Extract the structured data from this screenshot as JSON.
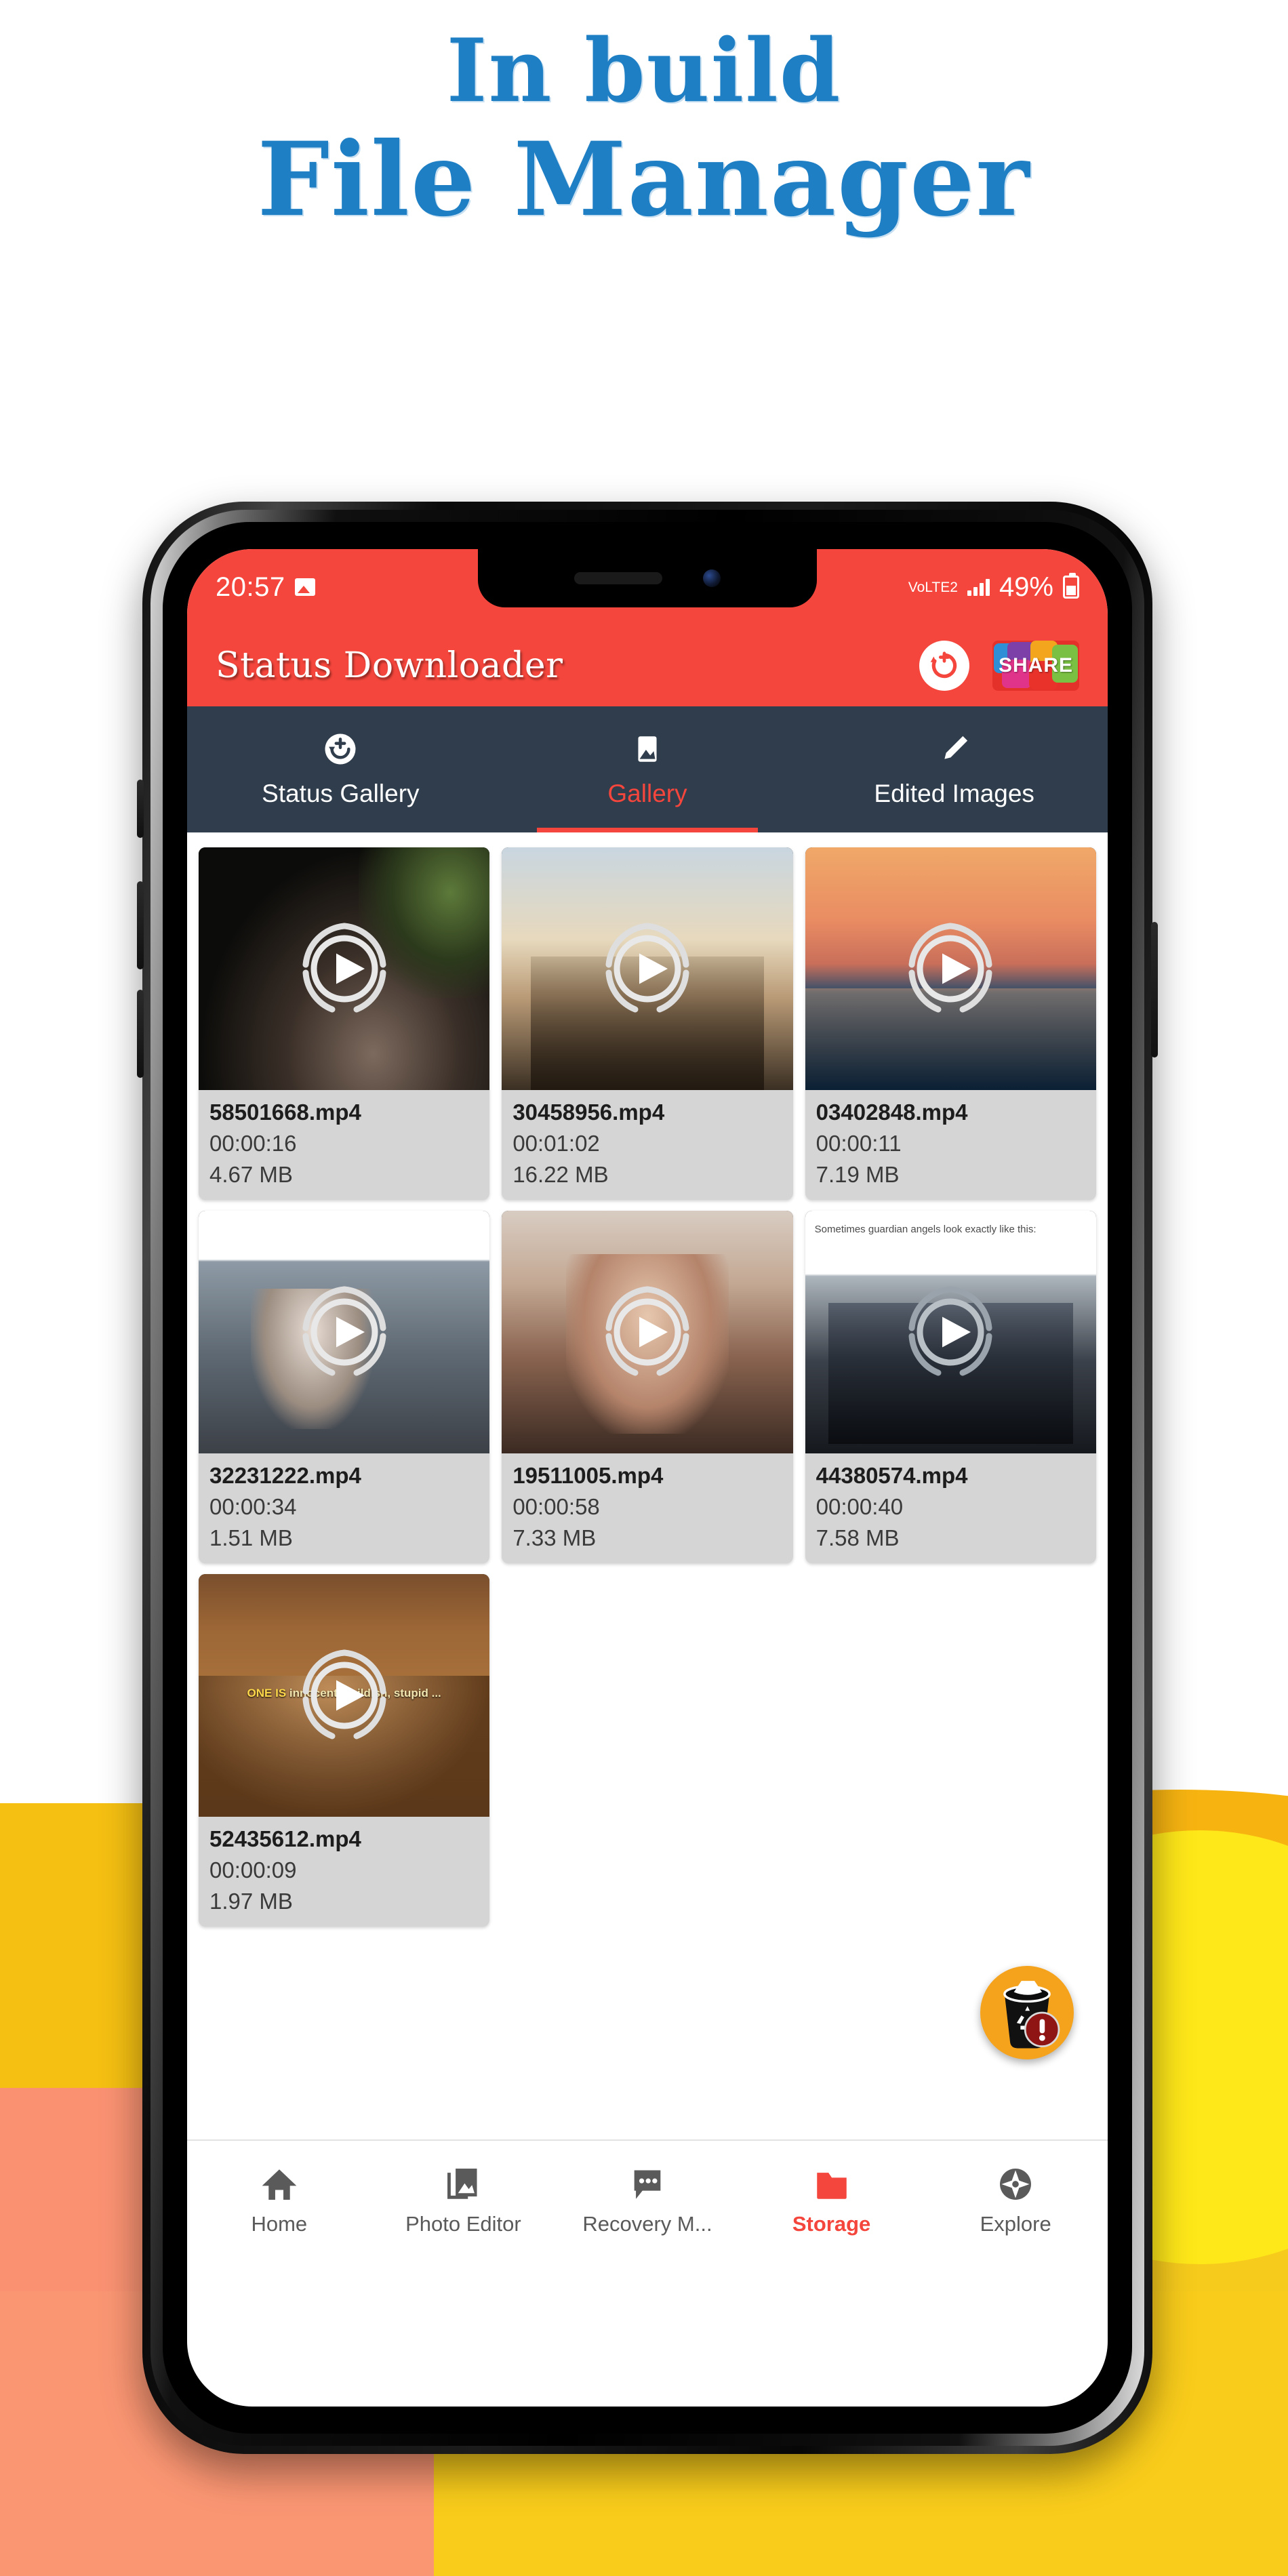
{
  "promo": {
    "line1": "In build",
    "line2": "File Manager",
    "accent_color": "#1f7fc4"
  },
  "status_bar": {
    "time": "20:57",
    "picture_icon": "image-icon",
    "network_label": "VoLTE2",
    "battery_percent": "49%",
    "battery_icon": "battery-charging-icon"
  },
  "app_bar": {
    "title": "Status Downloader",
    "refresh_icon": "refresh-icon",
    "share_label": "SHARE",
    "background_color": "#f4463c"
  },
  "tabs": {
    "active_index": 1,
    "background_color": "#2f3d4c",
    "active_color": "#f4463c",
    "items": [
      {
        "label": "Status Gallery",
        "icon": "sync-circle-icon"
      },
      {
        "label": "Gallery",
        "icon": "image-icon"
      },
      {
        "label": "Edited Images",
        "icon": "pencil-icon"
      }
    ]
  },
  "gallery": {
    "items": [
      {
        "filename": "58501668.mp4",
        "filename_prefix": "5",
        "duration": "00:00:16",
        "size": "4.67 MB",
        "scene": "scene-road",
        "caption": "",
        "play_icon": "play-circle-icon"
      },
      {
        "filename": "30458956.mp4",
        "filename_prefix": "3",
        "duration": "00:01:02",
        "size": "16.22 MB",
        "scene": "scene-street",
        "caption": "",
        "play_icon": "play-circle-icon"
      },
      {
        "filename": "03402848.mp4",
        "filename_prefix": "0",
        "duration": "00:00:11",
        "size": "7.19 MB",
        "scene": "scene-sunset",
        "caption": "",
        "play_icon": "play-circle-icon"
      },
      {
        "filename": "32231222.mp4",
        "filename_prefix": "3",
        "duration": "00:00:34",
        "size": "1.51 MB",
        "scene": "scene-news",
        "caption": "",
        "play_icon": "play-circle-icon"
      },
      {
        "filename": "19511005.mp4",
        "filename_prefix": "1",
        "duration": "00:00:58",
        "size": "7.33 MB",
        "scene": "scene-portrait",
        "caption": "",
        "play_icon": "play-circle-icon"
      },
      {
        "filename": "44380574.mp4",
        "filename_prefix": "4",
        "duration": "00:00:40",
        "size": "7.58 MB",
        "scene": "scene-men",
        "caption": "Sometimes guardian angels look exactly like this:",
        "play_icon": "play-circle-icon"
      },
      {
        "filename": "52435612.mp4",
        "filename_prefix": "5",
        "duration": "00:00:09",
        "size": "1.97 MB",
        "scene": "scene-lion",
        "caption": "",
        "overlay_text_1": "ONE IS",
        "overlay_text_2": "innocent, childish,",
        "overlay_text_3": "stupid ...",
        "play_icon": "play-circle-icon"
      }
    ],
    "delete_fab": {
      "icon": "trash-recycle-warning-icon",
      "background_color": "#f5a31d",
      "badge_color": "#8f1515"
    }
  },
  "bottom_nav": {
    "active_index": 3,
    "active_color": "#f4463c",
    "items": [
      {
        "label": "Home",
        "icon": "home-icon"
      },
      {
        "label": "Photo Editor",
        "icon": "photo-stack-icon"
      },
      {
        "label": "Recovery M...",
        "icon": "chat-bubble-icon"
      },
      {
        "label": "Storage",
        "icon": "folder-icon"
      },
      {
        "label": "Explore",
        "icon": "compass-icon"
      }
    ]
  }
}
